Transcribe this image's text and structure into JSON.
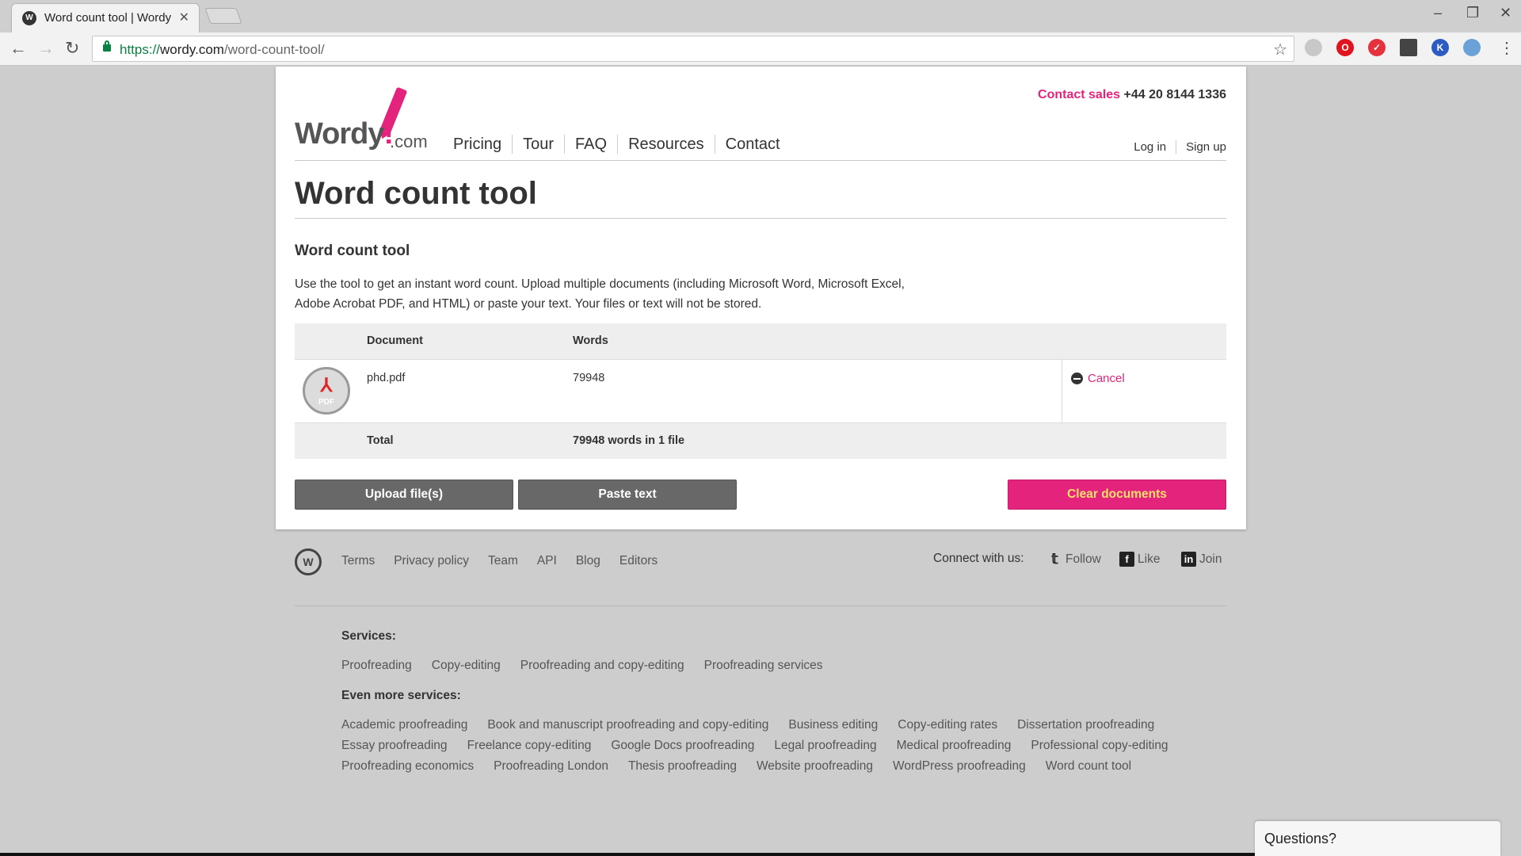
{
  "browser": {
    "tab_title": "Word count tool | Wordy",
    "tab_favicon": "W",
    "url_scheme": "https://",
    "url_host": "wordy.com",
    "url_path": "/word-count-tool/"
  },
  "header": {
    "logo_text": "Wordy",
    "logo_dot": "!",
    "logo_suffix": ".com",
    "contact_label": "Contact sales",
    "contact_phone": "+44 20 8144 1336",
    "nav": [
      "Pricing",
      "Tour",
      "FAQ",
      "Resources",
      "Contact"
    ],
    "login": "Log in",
    "signup": "Sign up"
  },
  "page": {
    "title": "Word count tool",
    "subtitle": "Word count tool",
    "intro": "Use the tool to get an instant word count. Upload multiple documents (including Microsoft Word, Microsoft Excel, Adobe Acrobat PDF, and HTML) or paste your text. Your files or text will not be stored."
  },
  "table": {
    "col_document": "Document",
    "col_words": "Words",
    "rows": [
      {
        "icon_label": "PDF",
        "document": "phd.pdf",
        "words": "79948",
        "action": "Cancel"
      }
    ],
    "total_label": "Total",
    "total_value": "79948 words in 1 file"
  },
  "buttons": {
    "upload": "Upload file(s)",
    "paste": "Paste text",
    "clear": "Clear documents"
  },
  "footer": {
    "logo_char": "W",
    "links": [
      "Terms",
      "Privacy policy",
      "Team",
      "API",
      "Blog",
      "Editors"
    ],
    "connect": "Connect with us:",
    "follow": "Follow",
    "like": "Like",
    "join": "Join",
    "services_heading": "Services:",
    "services": [
      "Proofreading",
      "Copy-editing",
      "Proofreading and copy-editing",
      "Proofreading services"
    ],
    "more_heading": "Even more services:",
    "more_services": [
      "Academic proofreading",
      "Book and manuscript proofreading and copy-editing",
      "Business editing",
      "Copy-editing rates",
      "Dissertation proofreading",
      "Essay proofreading",
      "Freelance copy-editing",
      "Google Docs proofreading",
      "Legal proofreading",
      "Medical proofreading",
      "Professional copy-editing",
      "Proofreading economics",
      "Proofreading London",
      "Thesis proofreading",
      "Website proofreading",
      "WordPress proofreading",
      "Word count tool"
    ]
  },
  "chat": {
    "label": "Questions?"
  },
  "colors": {
    "accent": "#e3237c",
    "button_gray": "#686868",
    "clear_text": "#f7e16b"
  }
}
